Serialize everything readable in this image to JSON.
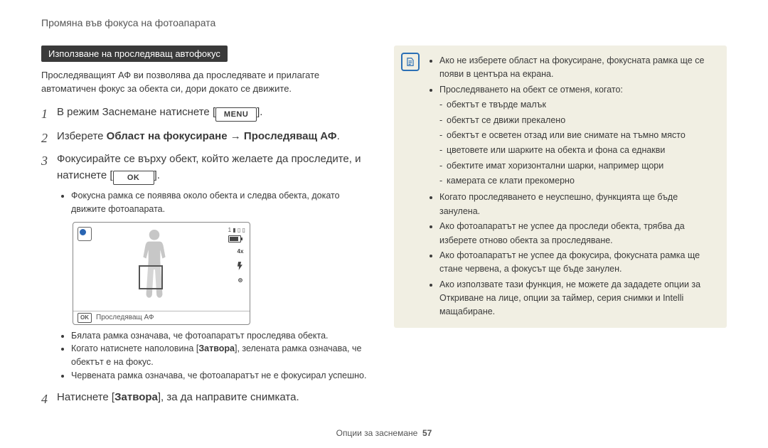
{
  "running_head": "Промяна във фокуса на фотоапарата",
  "section_heading": "Използване на проследяващ автофокус",
  "intro": "Проследяващият АФ ви позволява да проследявате и прилагате автоматичен фокус за обекта си, дори докато се движите.",
  "icons": {
    "menu": "MENU",
    "ok": "OK"
  },
  "steps": {
    "s1": {
      "pre": "В режим Заснемане натиснете [",
      "post": "]."
    },
    "s2": {
      "pre": "Изберете ",
      "focus_area": "Област на фокусиране",
      "arrow": " → ",
      "tracking": "Проследяващ АФ",
      "post": "."
    },
    "s3": {
      "pre": "Фокусирайте се върху обект, който желаете да проследите, и натиснете [",
      "post": "]."
    },
    "s3_note": "Фокусна рамка се появява около обекта и следва обекта, докато движите фотоапарата.",
    "s3_bullets": [
      "Бялата рамка означава, че фотоапаратът проследява обекта.",
      {
        "pre": "Когато натиснете наполовина [",
        "shutter": "Затвора",
        "post": "], зелената рамка означава, че обектът е на фокус."
      },
      "Червената рамка означава, че фотоапаратът не е фокусирал успешно."
    ],
    "s4": {
      "pre": "Натиснете [",
      "shutter": "Затвора",
      "post": "], за да направите снимката."
    }
  },
  "lcd": {
    "remaining": "1",
    "status_text": "Проследяващ АФ",
    "zoom": "4x"
  },
  "info": {
    "items": [
      "Ако не изберете област на фокусиране, фокусната рамка ще се появи в центъра на екрана.",
      {
        "lead": "Проследяването на обект се отменя, когато:",
        "sub": [
          "обектът е твърде малък",
          "обектът се движи прекалено",
          "обектът е осветен отзад или вие снимате на тъмно място",
          "цветовете или шарките на обекта и фона са еднакви",
          "обектите имат хоризонтални шарки, например щори",
          "камерата се клати прекомерно"
        ]
      },
      "Когато проследяването е неуспешно, функцията ще бъде занулена.",
      "Ако фотоапаратът не успее да проследи обекта, трябва да изберете отново обекта за проследяване.",
      "Ако фотоапаратът не успее да фокусира, фокусната рамка ще стане червена, а фокусът ще бъде занулен.",
      "Ако използвате тази функция, не можете да зададете опции за Откриване на лице, опции за таймер, серия снимки и Intelli мащабиране."
    ]
  },
  "footer": {
    "label": "Опции за заснемане",
    "page": "57"
  }
}
